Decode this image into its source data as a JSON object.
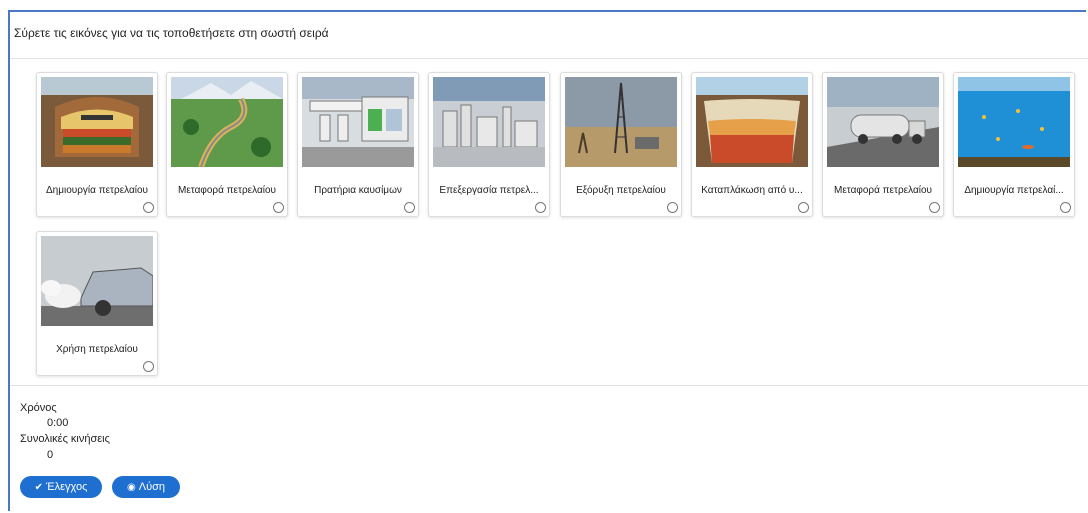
{
  "instruction": "Σύρετε τις εικόνες για να τις τοποθετήσετε στη σωστή σειρά",
  "cards": [
    {
      "label": "Δημιουργία πετρελαίου",
      "image": "underground-oil-layers"
    },
    {
      "label": "Μεταφορά πετρελαίου",
      "image": "pipeline-landscape"
    },
    {
      "label": "Πρατήρια καυσίμων",
      "image": "gas-station"
    },
    {
      "label": "Επεξεργασία πετρελ...",
      "image": "refinery"
    },
    {
      "label": "Εξόρυξη πετρελαίου",
      "image": "oil-derrick"
    },
    {
      "label": "Καταπλάκωση από υ...",
      "image": "sediment-burial"
    },
    {
      "label": "Μεταφορά πετρελαίου",
      "image": "tanker-truck"
    },
    {
      "label": "Δημιουργία πετρελαί...",
      "image": "ocean-plankton"
    },
    {
      "label": "Χρήση πετρελαίου",
      "image": "car-exhaust"
    }
  ],
  "stats": {
    "time_label": "Χρόνος",
    "time_value": "0:00",
    "moves_label": "Συνολικές κινήσεις",
    "moves_value": "0"
  },
  "buttons": {
    "check_label": "Έλεγχος",
    "check_icon": "checkmark-icon",
    "solution_label": "Λύση",
    "solution_icon": "eye-icon"
  },
  "colors": {
    "accent": "#1f6fd1",
    "frame_border": "#4a78c6"
  }
}
